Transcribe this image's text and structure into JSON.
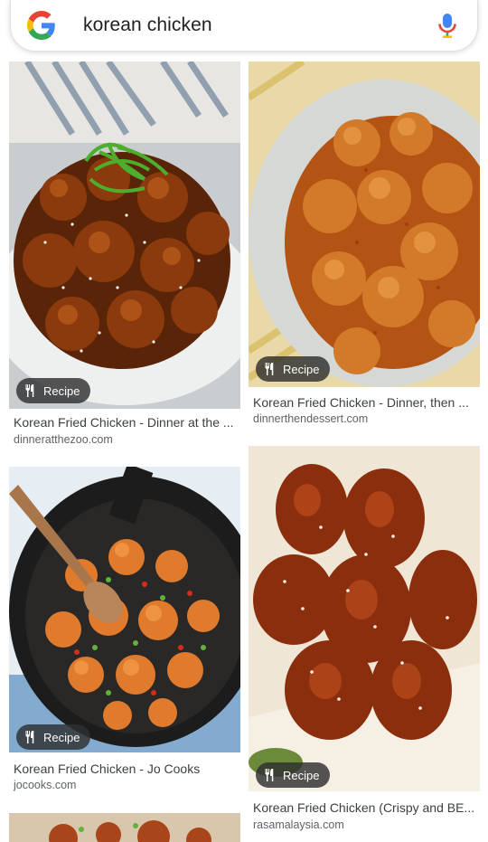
{
  "search": {
    "query": "korean chicken"
  },
  "results": [
    {
      "badge": "Recipe",
      "title": "Korean Fried Chicken - Dinner at the ...",
      "domain": "dinneratthezoo.com"
    },
    {
      "badge": "Recipe",
      "title": "Korean Fried Chicken - Dinner, then ...",
      "domain": "dinnerthendessert.com"
    },
    {
      "badge": "Recipe",
      "title": "Korean Fried Chicken - Jo Cooks",
      "domain": "jocooks.com"
    },
    {
      "badge": "Recipe",
      "title": "Korean Fried Chicken (Crispy and BE...",
      "domain": "rasamalaysia.com"
    }
  ],
  "colors": {
    "google_blue": "#4285F4",
    "google_red": "#EA4335",
    "google_yellow": "#FBBC05",
    "google_green": "#34A853"
  }
}
